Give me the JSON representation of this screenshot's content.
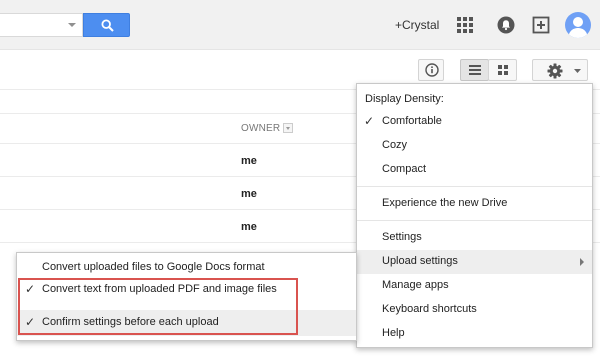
{
  "header": {
    "user_name": "+Crystal",
    "search_icon": "search-icon",
    "apps_icon": "apps-grid-icon",
    "notifications_icon": "notifications-icon",
    "share_icon": "add-share-icon",
    "avatar_icon": "user-avatar-icon",
    "accent_color": "#4d8ef0"
  },
  "toolbar": {
    "info_icon": "info-icon",
    "list_view_icon": "list-view-icon",
    "grid_view_icon": "grid-view-icon",
    "settings_icon": "gear-icon"
  },
  "file_list": {
    "owner_column": "OWNER",
    "rows": [
      {
        "owner": "me"
      },
      {
        "owner": "me"
      },
      {
        "owner": "me"
      }
    ]
  },
  "settings_menu": {
    "density_header": "Display Density:",
    "density_options": [
      {
        "label": "Comfortable",
        "checked": true
      },
      {
        "label": "Cozy",
        "checked": false
      },
      {
        "label": "Compact",
        "checked": false
      }
    ],
    "experience": "Experience the new Drive",
    "items": [
      {
        "label": "Settings"
      },
      {
        "label": "Upload settings",
        "has_submenu": true,
        "highlighted": true
      },
      {
        "label": "Manage apps"
      },
      {
        "label": "Keyboard shortcuts"
      },
      {
        "label": "Help"
      }
    ]
  },
  "upload_submenu": {
    "items": [
      {
        "label": "Convert uploaded files to Google Docs format",
        "checked": false
      },
      {
        "label": "Convert text from uploaded PDF and image files",
        "checked": true
      },
      {
        "label": "Confirm settings before each upload",
        "checked": true,
        "highlighted": true
      }
    ],
    "annotation_color": "#d9534f"
  }
}
